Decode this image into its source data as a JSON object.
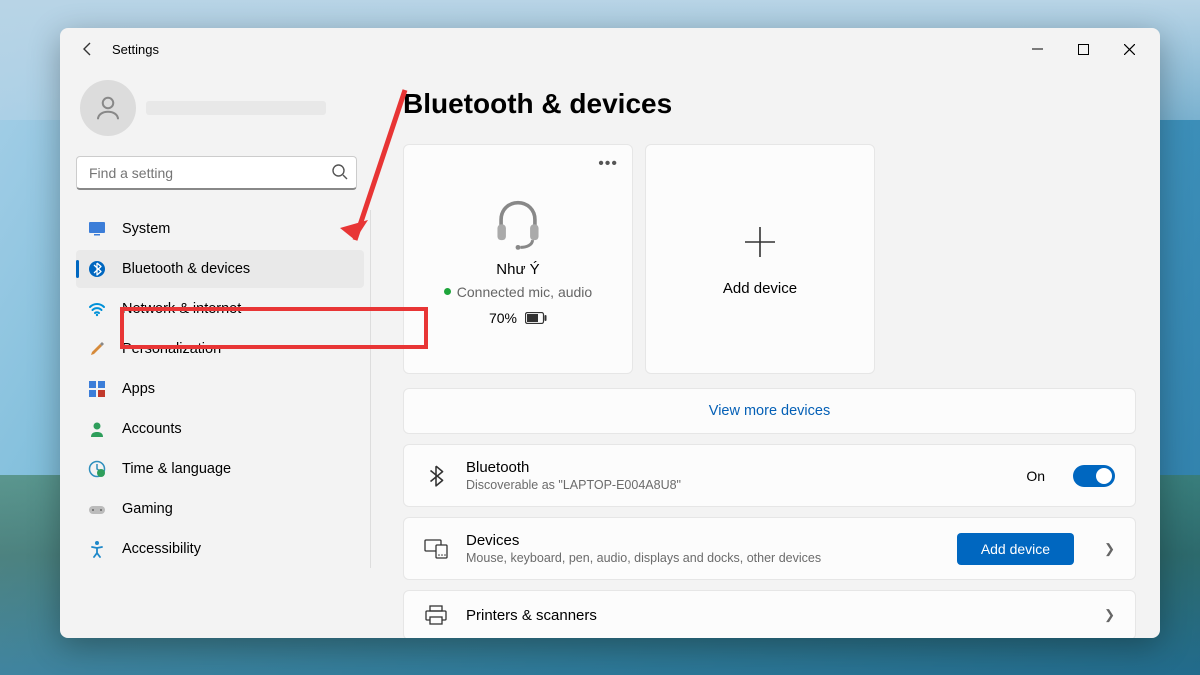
{
  "window": {
    "title": "Settings"
  },
  "search": {
    "placeholder": "Find a setting"
  },
  "nav": {
    "items": [
      {
        "label": "System"
      },
      {
        "label": "Bluetooth & devices"
      },
      {
        "label": "Network & internet"
      },
      {
        "label": "Personalization"
      },
      {
        "label": "Apps"
      },
      {
        "label": "Accounts"
      },
      {
        "label": "Time & language"
      },
      {
        "label": "Gaming"
      },
      {
        "label": "Accessibility"
      }
    ],
    "activeIndex": 1
  },
  "page": {
    "heading": "Bluetooth & devices",
    "device_card": {
      "name": "Như Ý",
      "status": "Connected mic, audio",
      "battery_percent": "70%"
    },
    "add_card": {
      "label": "Add device"
    },
    "view_more": "View more devices",
    "bluetooth_row": {
      "title": "Bluetooth",
      "desc": "Discoverable as \"LAPTOP-E004A8U8\"",
      "state_label": "On"
    },
    "devices_row": {
      "title": "Devices",
      "desc": "Mouse, keyboard, pen, audio, displays and docks, other devices",
      "button": "Add device"
    },
    "printers_row": {
      "title": "Printers & scanners"
    }
  },
  "colors": {
    "accent": "#0067c0",
    "highlight_red": "#e83535"
  }
}
